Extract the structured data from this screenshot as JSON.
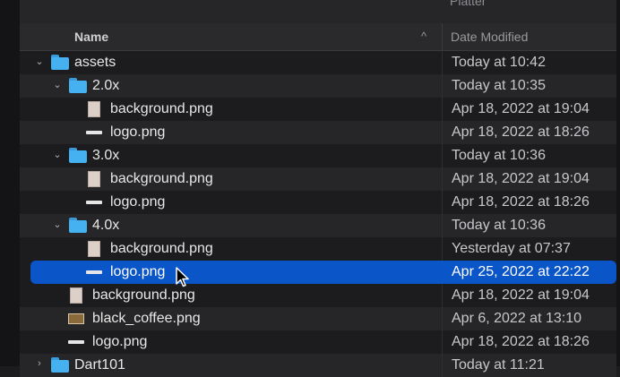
{
  "header": {
    "partial_title": "Platter",
    "name_col": "Name",
    "date_col": "Date Modified",
    "sort_indicator": "^"
  },
  "rows": [
    {
      "name": "assets",
      "date": "Today at 10:42",
      "icon": "folder-icon",
      "expanded": true
    },
    {
      "name": "2.0x",
      "date": "Today at 10:35",
      "icon": "folder-icon",
      "expanded": true
    },
    {
      "name": "background.png",
      "date": "Apr 18, 2022 at 19:04",
      "icon": "image-file-icon"
    },
    {
      "name": "logo.png",
      "date": "Apr 18, 2022 at 18:26",
      "icon": "logo-file-icon"
    },
    {
      "name": "3.0x",
      "date": "Today at 10:36",
      "icon": "folder-icon",
      "expanded": true
    },
    {
      "name": "background.png",
      "date": "Apr 18, 2022 at 19:04",
      "icon": "image-file-icon"
    },
    {
      "name": "logo.png",
      "date": "Apr 18, 2022 at 18:26",
      "icon": "logo-file-icon"
    },
    {
      "name": "4.0x",
      "date": "Today at 10:36",
      "icon": "folder-icon",
      "expanded": true
    },
    {
      "name": "background.png",
      "date": "Yesterday at 07:37",
      "icon": "image-file-icon"
    },
    {
      "name": "logo.png",
      "date": "Apr 25, 2022 at 22:22",
      "icon": "logo-file-icon",
      "selected": true
    },
    {
      "name": "background.png",
      "date": "Apr 18, 2022 at 19:04",
      "icon": "image-file-icon"
    },
    {
      "name": "black_coffee.png",
      "date": "Apr 6, 2022 at 13:10",
      "icon": "photo-file-icon"
    },
    {
      "name": "logo.png",
      "date": "Apr 18, 2022 at 18:26",
      "icon": "logo-file-icon"
    },
    {
      "name": "Dart101",
      "date": "Today at 11:21",
      "icon": "folder-icon",
      "expanded": false
    }
  ],
  "colors": {
    "selection": "#0a55c8",
    "folder": "#45b1f0",
    "background": "#1c1c1e"
  }
}
